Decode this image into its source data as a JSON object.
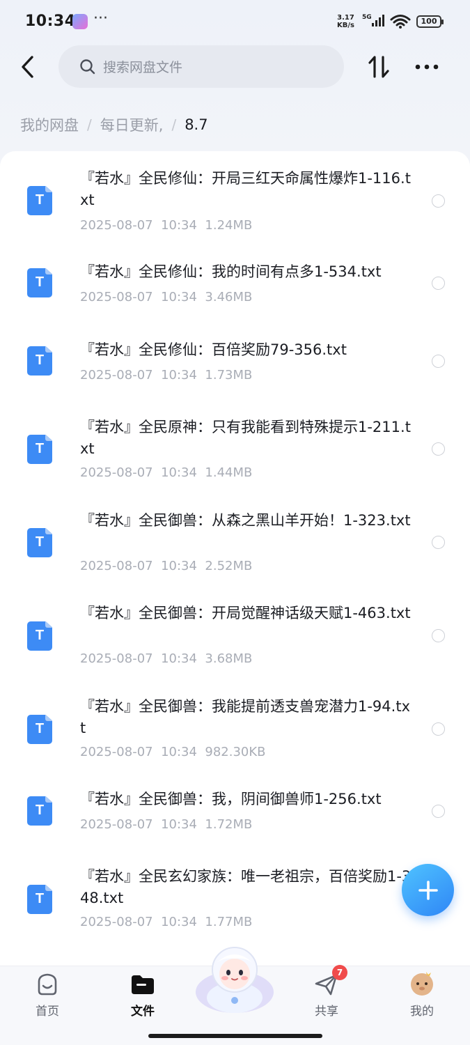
{
  "status_bar": {
    "time": "10:34",
    "speed_top": "3.17",
    "speed_bottom": "KB/s",
    "network": "5G",
    "battery": "100"
  },
  "header": {
    "search_placeholder": "搜索网盘文件"
  },
  "breadcrumb": {
    "items": [
      "我的网盘",
      "每日更新,"
    ],
    "current": "8.7"
  },
  "files": [
    {
      "name": "『若水』全民修仙：开局三红天命属性爆炸1-116.txt",
      "date": "2025-08-07",
      "time": "10:34",
      "size": "1.24MB"
    },
    {
      "name": "『若水』全民修仙：我的时间有点多1-534.txt",
      "date": "2025-08-07",
      "time": "10:34",
      "size": "3.46MB"
    },
    {
      "name": "『若水』全民修仙：百倍奖励79-356.txt",
      "date": "2025-08-07",
      "time": "10:34",
      "size": "1.73MB"
    },
    {
      "name": "『若水』全民原神：只有我能看到特殊提示1-211.txt",
      "date": "2025-08-07",
      "time": "10:34",
      "size": "1.44MB"
    },
    {
      "name": "『若水』全民御兽：从森之黑山羊开始！1-323.txt",
      "date": "2025-08-07",
      "time": "10:34",
      "size": "2.52MB"
    },
    {
      "name": "『若水』全民御兽：开局觉醒神话级天赋1-463.txt",
      "date": "2025-08-07",
      "time": "10:34",
      "size": "3.68MB"
    },
    {
      "name": "『若水』全民御兽：我能提前透支兽宠潜力1-94.txt",
      "date": "2025-08-07",
      "time": "10:34",
      "size": "982.30KB"
    },
    {
      "name": "『若水』全民御兽：我，阴间御兽师1-256.txt",
      "date": "2025-08-07",
      "time": "10:34",
      "size": "1.72MB"
    },
    {
      "name": "『若水』全民玄幻家族：唯一老祖宗，百倍奖励1-348.txt",
      "date": "2025-08-07",
      "time": "10:34",
      "size": "1.77MB"
    }
  ],
  "bottom_nav": {
    "items": [
      {
        "label": "首页",
        "icon": "home-icon"
      },
      {
        "label": "文件",
        "icon": "folder-icon"
      },
      {
        "label": "共享",
        "icon": "share-icon",
        "badge": "7"
      },
      {
        "label": "我的",
        "icon": "avatar-icon"
      }
    ]
  },
  "colors": {
    "accent": "#3d8bf5",
    "fab": "#2f86f6",
    "badge": "#f04b4b"
  }
}
